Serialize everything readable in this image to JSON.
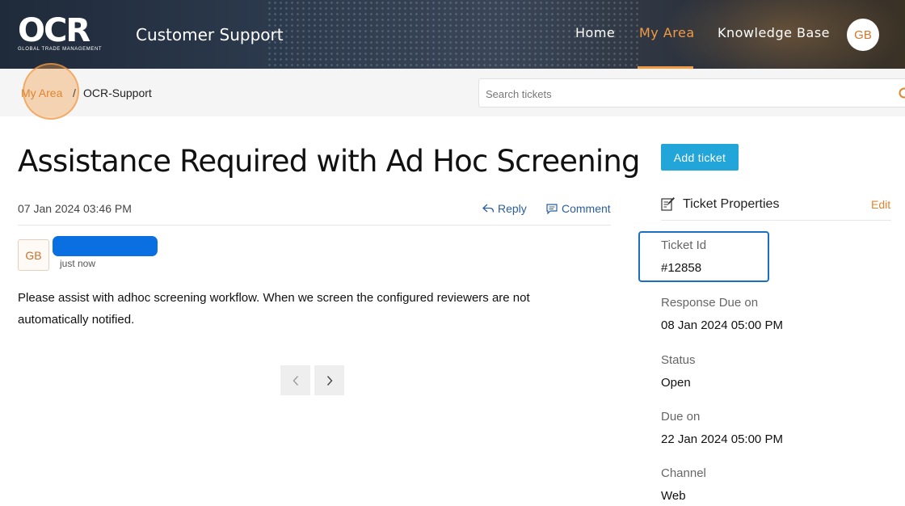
{
  "header": {
    "logo_text": "OCR",
    "logo_subtext": "GLOBAL TRADE MANAGEMENT",
    "title": "Customer Support",
    "nav": [
      {
        "label": "Home"
      },
      {
        "label": "My Area"
      },
      {
        "label": "Knowledge Base"
      }
    ],
    "avatar_initials": "GB",
    "accent_color": "#f29a44"
  },
  "breadcrumb": {
    "items": [
      {
        "label": "My Area"
      },
      {
        "label": "OCR-Support"
      }
    ],
    "separator": "/"
  },
  "search": {
    "placeholder": "Search tickets",
    "value": ""
  },
  "ticket": {
    "title": "Assistance Required with Ad Hoc Screening",
    "date": "07 Jan 2024 03:46 PM",
    "reply_label": "Reply",
    "comment_label": "Comment",
    "message": {
      "author_initials": "GB",
      "time": "just now",
      "body": "Please assist with adhoc screening workflow.  When we screen the configured reviewers are not automatically notified."
    }
  },
  "sidebar": {
    "add_ticket_label": "Add ticket",
    "properties_title": "Ticket Properties",
    "edit_label": "Edit",
    "properties": [
      {
        "label": "Ticket Id",
        "value": "#12858"
      },
      {
        "label": "Response Due on",
        "value": "08 Jan 2024 05:00 PM"
      },
      {
        "label": "Status",
        "value": "Open"
      },
      {
        "label": "Due on",
        "value": "22 Jan 2024 05:00 PM"
      },
      {
        "label": "Channel",
        "value": "Web"
      }
    ]
  },
  "icons": {
    "search": "search-icon",
    "reply": "reply-icon",
    "comment": "comment-icon",
    "edit_note": "edit-note-icon",
    "prev": "chevron-left-icon",
    "next": "chevron-right-icon"
  }
}
